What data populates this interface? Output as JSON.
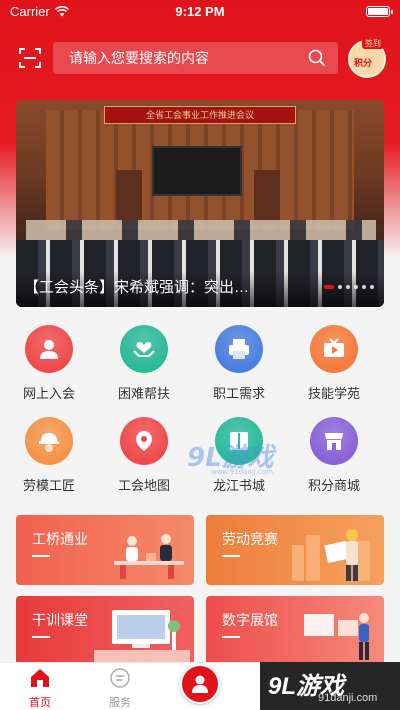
{
  "status_bar": {
    "carrier": "Carrier",
    "time": "9:12 PM"
  },
  "search": {
    "placeholder": "请输入您要搜索的内容"
  },
  "sign_in": {
    "badge": "签到",
    "label": "积分"
  },
  "banner": {
    "sign_text": "全省工会事业工作推进会议",
    "caption": "【工会头条】宋希斌强调：突出…",
    "dots": 6,
    "active_dot": 0
  },
  "services": [
    {
      "label": "网上入会",
      "icon": "person-join-icon",
      "color": "#ef4a4a"
    },
    {
      "label": "困难帮扶",
      "icon": "heart-hands-icon",
      "color": "#2bb99b"
    },
    {
      "label": "职工需求",
      "icon": "printer-icon",
      "color": "#4a7fe0"
    },
    {
      "label": "技能学苑",
      "icon": "video-play-icon",
      "color": "#f57c3c"
    },
    {
      "label": "劳模工匠",
      "icon": "worker-helmet-icon",
      "color": "#f5934a"
    },
    {
      "label": "工会地图",
      "icon": "map-pin-icon",
      "color": "#ef4a4a"
    },
    {
      "label": "龙江书城",
      "icon": "book-icon",
      "color": "#2bb99b"
    },
    {
      "label": "积分商城",
      "icon": "shop-icon",
      "color": "#8a62d8"
    }
  ],
  "cards": [
    {
      "title": "工桥通业",
      "color_from": "#f2614f",
      "color_to": "#f48a6a"
    },
    {
      "title": "劳动竞赛",
      "color_from": "#ef7d3c",
      "color_to": "#f5a15e"
    },
    {
      "title": "干训课堂",
      "color_from": "#e83a3a",
      "color_to": "#f06262"
    },
    {
      "title": "数字展馆",
      "color_from": "#ee4d4d",
      "color_to": "#f58a7a"
    }
  ],
  "tabbar": {
    "tabs": [
      {
        "label": "首页",
        "active": true
      },
      {
        "label": "服务",
        "active": false
      }
    ]
  },
  "watermark": {
    "brand": "9L游戏",
    "site": "91danji.com"
  },
  "colors": {
    "primary": "#e0131b",
    "text": "#333333"
  }
}
